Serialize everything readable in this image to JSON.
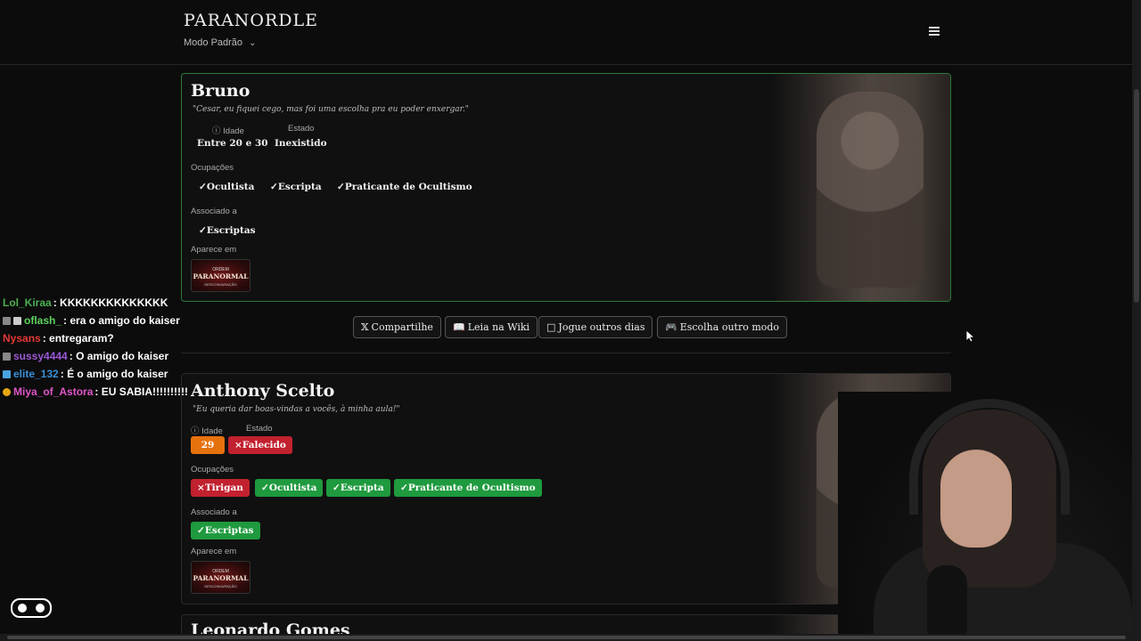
{
  "header": {
    "logo": "PARANORDLE",
    "mode_label": "Modo Padrão"
  },
  "cards": [
    {
      "name": "Bruno",
      "quote": "\"Cesar, eu fiquei cego, mas foi uma escolha pra eu poder enxergar.\"",
      "age_label": "Idade",
      "age_value": "Entre 20 e 30",
      "state_label": "Estado",
      "state_value": "Inexistido",
      "occupations_label": "Ocupações",
      "occupations": [
        "Ocultista",
        "Escripta",
        "Praticante de Ocultismo"
      ],
      "associated_label": "Associado a",
      "associated": [
        "Escriptas"
      ],
      "appears_label": "Aparece em",
      "appears_thumb": {
        "top": "ORDEM",
        "title": "PARANORMAL",
        "sub": "DESCONJURAÇÃO"
      }
    },
    {
      "name": "Anthony Scelto",
      "quote": "\"Eu queria dar boas-vindas a vocês, à minha aula!\"",
      "age_label": "Idade",
      "age_value": "29",
      "state_label": "Estado",
      "state_value": "Falecido",
      "occupations_label": "Ocupações",
      "occupations": [
        {
          "label": "Tirigan",
          "status": "wrong"
        },
        {
          "label": "Ocultista",
          "status": "right"
        },
        {
          "label": "Escripta",
          "status": "right"
        },
        {
          "label": "Praticante de Ocultismo",
          "status": "right"
        }
      ],
      "associated_label": "Associado a",
      "associated": [
        "Escriptas"
      ],
      "appears_label": "Aparece em",
      "appears_thumb": {
        "top": "ORDEM",
        "title": "PARANORMAL",
        "sub": "DESCONJURAÇÃO"
      }
    }
  ],
  "next_card_name": "Leonardo Gomes",
  "buttons": {
    "share": "Compartilhe",
    "wiki": "Leia na Wiki",
    "other_days": "Jogue outros dias",
    "other_mode": "Escolha outro modo"
  },
  "chat": [
    {
      "user": "Lol_Kiraa",
      "color": "#4caf50",
      "msg": "KKKKKKKKKKKKKK"
    },
    {
      "user": "oflash_",
      "color": "#5fd35f",
      "msg": "era o amigo do kaiser"
    },
    {
      "user": "Nysans",
      "color": "#e53935",
      "msg": "entregaram?"
    },
    {
      "user": "sussy4444",
      "color": "#9b59d6",
      "msg": "O amigo do kaiser"
    },
    {
      "user": "elite_132",
      "color": "#3a8fd6",
      "msg": "É o amigo do kaiser"
    },
    {
      "user": "Miya_of_Astora",
      "color": "#e055c8",
      "msg": "EU SABIA!!!!!!!!!!"
    }
  ],
  "colors": {
    "correct": "#1f9a3e",
    "wrong": "#c2212f",
    "partial": "#e6720e",
    "card_border_correct": "#2e7a3a"
  },
  "icons": [
    "chevron-down-icon",
    "menu-icon",
    "info-icon",
    "x-logo-icon",
    "book-icon",
    "calendar-icon",
    "gamepad-icon",
    "check-icon",
    "cross-icon"
  ]
}
